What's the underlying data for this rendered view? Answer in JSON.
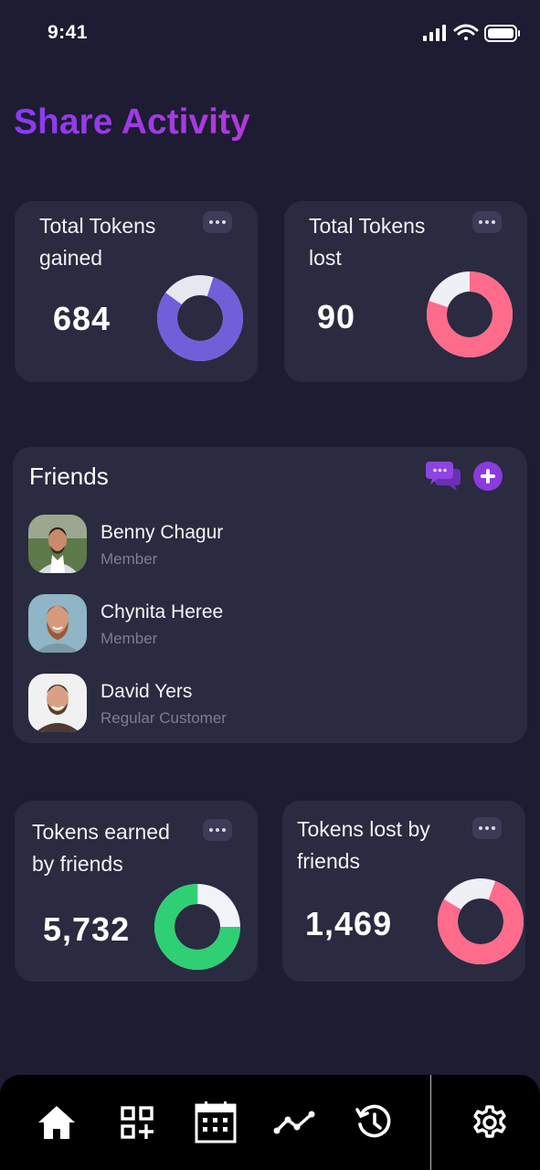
{
  "status_bar": {
    "time": "9:41"
  },
  "page_title": "Share Activity",
  "stats": [
    {
      "title_line1": "Total Tokens",
      "title_line2": "gained",
      "value": "684",
      "ring_color": "#6f5fd8",
      "ring_share": 0.8
    },
    {
      "title_line1": "Total Tokens",
      "title_line2": "lost",
      "value": "90",
      "ring_color": "#ff6b8b",
      "ring_share": 0.8
    },
    {
      "title_line1": "Tokens earned",
      "title_line2": "by friends",
      "value": "5,732",
      "ring_color": "#2fcf73",
      "ring_share": 0.75
    },
    {
      "title_line1": "Tokens lost by",
      "title_line2": "friends",
      "value": "1,469",
      "ring_color": "#ff6b8b",
      "ring_share": 0.78
    }
  ],
  "friends": {
    "title": "Friends",
    "items": [
      {
        "name": "Benny Chagur",
        "role": "Member"
      },
      {
        "name": "Chynita Heree",
        "role": "Member"
      },
      {
        "name": "David Yers",
        "role": "Regular Customer"
      }
    ]
  },
  "colors": {
    "background": "#1d1c33",
    "card": "#2a2a40",
    "accent": "#8a3bf0"
  },
  "nav": {
    "items": [
      "home-icon",
      "qr-code-add-icon",
      "calendar-icon",
      "activity-chart-icon",
      "history-icon"
    ],
    "settings": "gear-icon"
  }
}
